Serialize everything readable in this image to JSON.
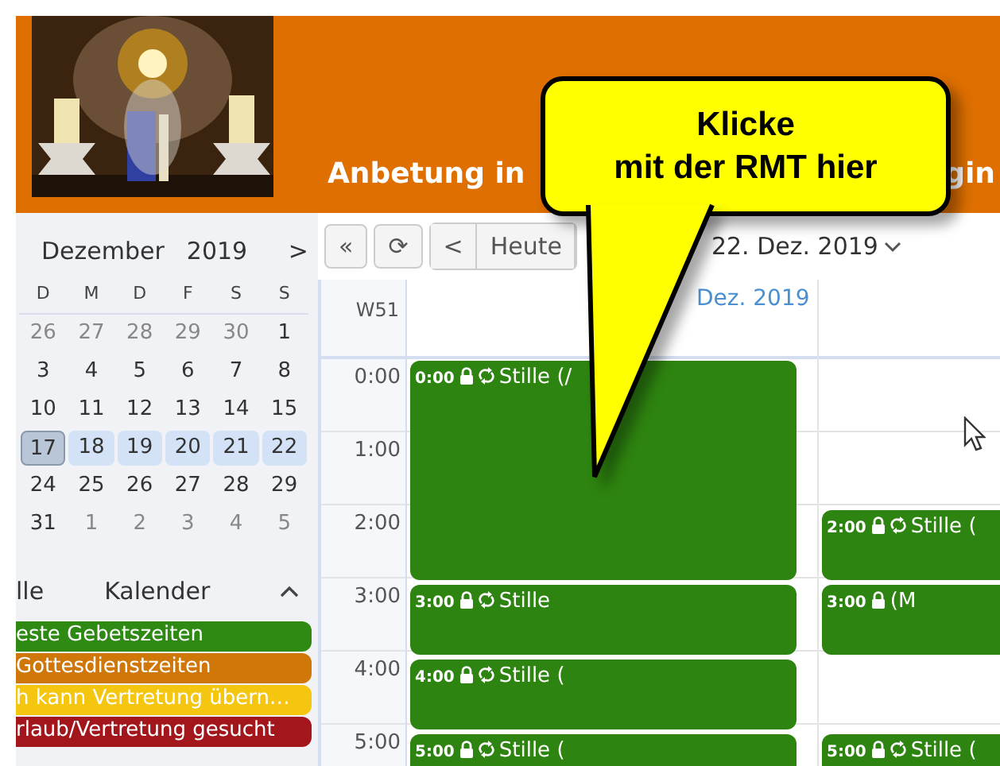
{
  "header": {
    "picture": {
      "kind": "picture"
    },
    "title_parts": [
      "Anbetung in",
      "gin"
    ]
  },
  "mini_calendar": {
    "month": "Dezember",
    "year": "2019",
    "next": ">",
    "weekdays": [
      "D",
      "M",
      "D",
      "F",
      "S",
      "S"
    ],
    "weeks": [
      [
        {
          "day": "26",
          "muted": true,
          "in_week": false,
          "selected": false
        },
        {
          "day": "27",
          "muted": true,
          "in_week": false,
          "selected": false
        },
        {
          "day": "28",
          "muted": true,
          "in_week": false,
          "selected": false
        },
        {
          "day": "29",
          "muted": true,
          "in_week": false,
          "selected": false
        },
        {
          "day": "30",
          "muted": true,
          "in_week": false,
          "selected": false
        },
        {
          "day": "1",
          "muted": false,
          "in_week": false,
          "selected": false
        }
      ],
      [
        {
          "day": "3",
          "muted": false,
          "in_week": false,
          "selected": false
        },
        {
          "day": "4",
          "muted": false,
          "in_week": false,
          "selected": false
        },
        {
          "day": "5",
          "muted": false,
          "in_week": false,
          "selected": false
        },
        {
          "day": "6",
          "muted": false,
          "in_week": false,
          "selected": false
        },
        {
          "day": "7",
          "muted": false,
          "in_week": false,
          "selected": false
        },
        {
          "day": "8",
          "muted": false,
          "in_week": false,
          "selected": false
        }
      ],
      [
        {
          "day": "10",
          "muted": false,
          "in_week": false,
          "selected": false
        },
        {
          "day": "11",
          "muted": false,
          "in_week": false,
          "selected": false
        },
        {
          "day": "12",
          "muted": false,
          "in_week": false,
          "selected": false
        },
        {
          "day": "13",
          "muted": false,
          "in_week": false,
          "selected": false
        },
        {
          "day": "14",
          "muted": false,
          "in_week": false,
          "selected": false
        },
        {
          "day": "15",
          "muted": false,
          "in_week": false,
          "selected": false
        }
      ],
      [
        {
          "day": "17",
          "muted": false,
          "in_week": true,
          "selected": true
        },
        {
          "day": "18",
          "muted": false,
          "in_week": true,
          "selected": false
        },
        {
          "day": "19",
          "muted": false,
          "in_week": true,
          "selected": false
        },
        {
          "day": "20",
          "muted": false,
          "in_week": true,
          "selected": false
        },
        {
          "day": "21",
          "muted": false,
          "in_week": true,
          "selected": false
        },
        {
          "day": "22",
          "muted": false,
          "in_week": true,
          "selected": false
        }
      ],
      [
        {
          "day": "24",
          "muted": false,
          "in_week": false,
          "selected": false
        },
        {
          "day": "25",
          "muted": false,
          "in_week": false,
          "selected": false
        },
        {
          "day": "26",
          "muted": false,
          "in_week": false,
          "selected": false
        },
        {
          "day": "27",
          "muted": false,
          "in_week": false,
          "selected": false
        },
        {
          "day": "28",
          "muted": false,
          "in_week": false,
          "selected": false
        },
        {
          "day": "29",
          "muted": false,
          "in_week": false,
          "selected": false
        }
      ],
      [
        {
          "day": "31",
          "muted": false,
          "in_week": false,
          "selected": false
        },
        {
          "day": "1",
          "muted": true,
          "in_week": false,
          "selected": false
        },
        {
          "day": "2",
          "muted": true,
          "in_week": false,
          "selected": false
        },
        {
          "day": "3",
          "muted": true,
          "in_week": false,
          "selected": false
        },
        {
          "day": "4",
          "muted": true,
          "in_week": false,
          "selected": false
        },
        {
          "day": "5",
          "muted": true,
          "in_week": false,
          "selected": false
        }
      ]
    ]
  },
  "calendars": {
    "all_label": "lle",
    "title": "Kalender",
    "expanded": true,
    "items": [
      {
        "label": "este Gebetszeiten",
        "color": "#2e8a12"
      },
      {
        "label": "Gottesdienstzeiten",
        "color": "#cf7708"
      },
      {
        "label": "h kann Vertretung übern…",
        "color": "#f5c60f"
      },
      {
        "label": "rlaub/Vertretung gesucht",
        "color": "#a3161c"
      }
    ]
  },
  "toolbar": {
    "buttons": [
      "«",
      "⟳",
      "<"
    ],
    "today": "Heute",
    "range": "22. Dez. 2019"
  },
  "week_view": {
    "week": "W51",
    "day_header": "Dez. 2019",
    "hours": [
      "0:00",
      "1:00",
      "2:00",
      "3:00",
      "4:00",
      "5:00"
    ],
    "columns": [
      [
        {
          "time": "0:00",
          "title": "Stille (/",
          "locked": true,
          "recurring": true,
          "kind": "long"
        },
        {
          "time": "3:00",
          "title": "Stille",
          "locked": true,
          "recurring": true,
          "kind": "short"
        },
        {
          "time": "4:00",
          "title": "Stille (",
          "locked": true,
          "recurring": true,
          "kind": "short"
        },
        {
          "time": "5:00",
          "title": "Stille (",
          "locked": true,
          "recurring": true,
          "kind": "short"
        }
      ],
      [
        {
          "time": "2:00",
          "title": "Stille (",
          "locked": true,
          "recurring": true,
          "kind": "short"
        },
        {
          "time": "3:00",
          "title": "(M",
          "locked": true,
          "recurring": false,
          "kind": "short"
        },
        {
          "time": "5:00",
          "title": "Stille (",
          "locked": true,
          "recurring": true,
          "kind": "short"
        }
      ]
    ]
  },
  "callout": {
    "lines": [
      "Klicke",
      "mit der RMT hier"
    ]
  }
}
